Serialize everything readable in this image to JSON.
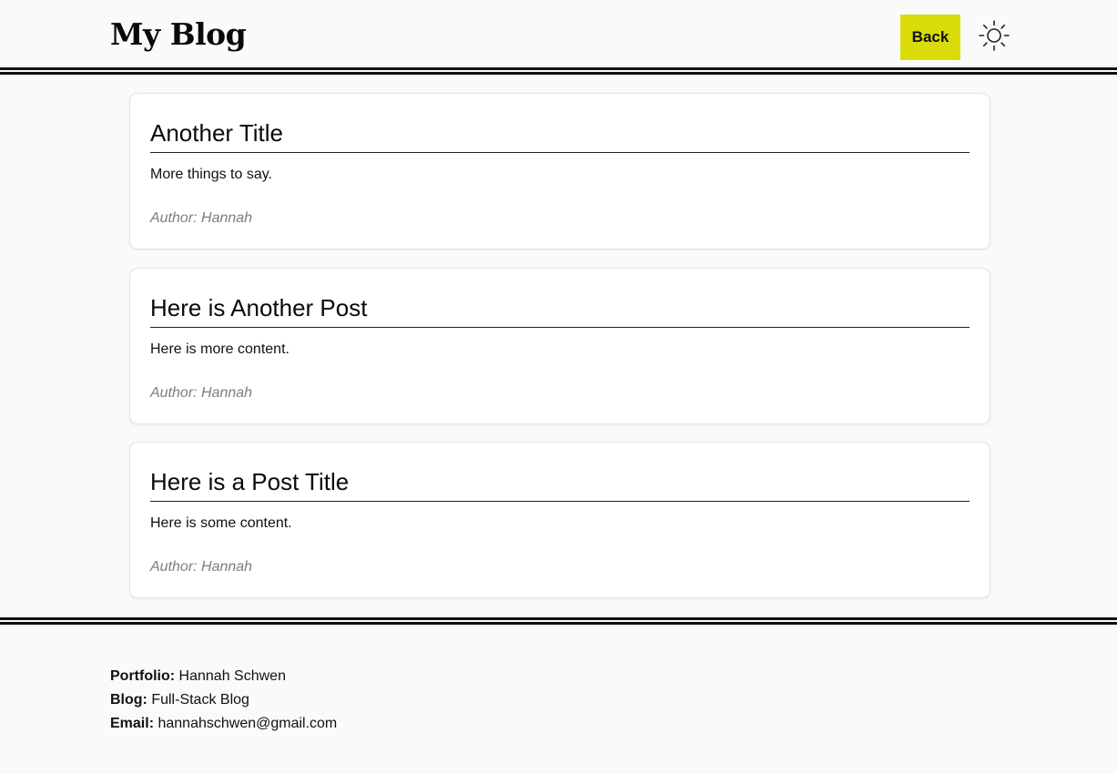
{
  "header": {
    "title": "My Blog",
    "back_label": "Back",
    "theme_icon": "sun-icon",
    "accent_color": "#d9db0a"
  },
  "posts": [
    {
      "title": "Another Title",
      "body": "More things to say.",
      "author": "Author: Hannah"
    },
    {
      "title": "Here is Another Post",
      "body": "Here is more content.",
      "author": "Author: Hannah"
    },
    {
      "title": "Here is a Post Title",
      "body": "Here is some content.",
      "author": "Author: Hannah"
    }
  ],
  "footer": {
    "portfolio_label": "Portfolio:",
    "portfolio_value": "Hannah Schwen",
    "blog_label": "Blog:",
    "blog_value": "Full-Stack Blog",
    "email_label": "Email:",
    "email_value": "hannahschwen@gmail.com"
  }
}
